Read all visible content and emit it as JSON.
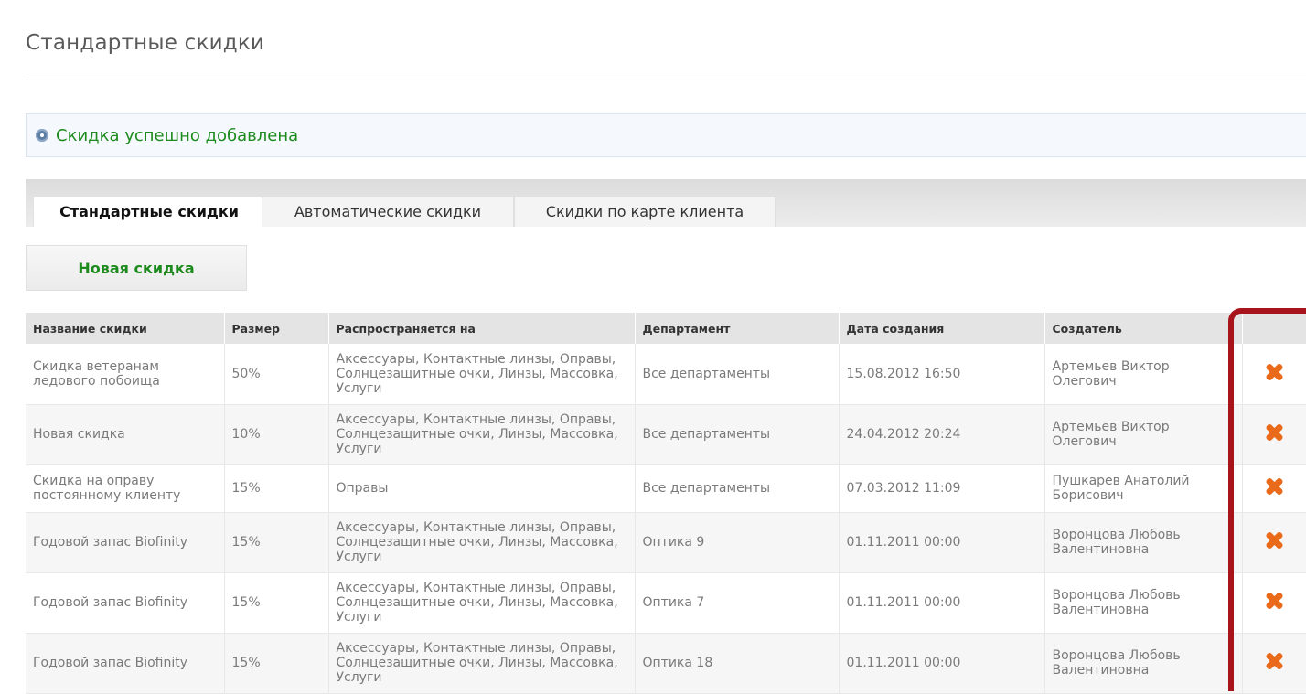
{
  "page": {
    "title": "Стандартные скидки"
  },
  "notice": {
    "text": "Скидка успешно добавлена"
  },
  "tabs": [
    {
      "label": "Стандартные скидки",
      "active": true
    },
    {
      "label": "Автоматические скидки",
      "active": false
    },
    {
      "label": "Скидки по карте клиента",
      "active": false
    }
  ],
  "new_button": {
    "label": "Новая скидка"
  },
  "table": {
    "headers": [
      "Название скидки",
      "Размер",
      "Распространяется на",
      "Департамент",
      "Дата создания",
      "Создатель"
    ],
    "rows": [
      {
        "name": "Скидка ветеранам ледового побоища",
        "size": "50%",
        "applies": "Аксессуары, Контактные линзы, Оправы, Солнцезащитные очки, Линзы, Массовка, Услуги",
        "dept": "Все департаменты",
        "date": "15.08.2012 16:50",
        "creator": "Артемьев Виктор Олегович"
      },
      {
        "name": "Новая скидка",
        "size": "10%",
        "applies": "Аксессуары, Контактные линзы, Оправы, Солнцезащитные очки, Линзы, Массовка, Услуги",
        "dept": "Все департаменты",
        "date": "24.04.2012 20:24",
        "creator": "Артемьев Виктор Олегович"
      },
      {
        "name": "Скидка на оправу постоянному клиенту",
        "size": "15%",
        "applies": "Оправы",
        "dept": "Все департаменты",
        "date": "07.03.2012 11:09",
        "creator": "Пушкарев Анатолий Борисович"
      },
      {
        "name": "Годовой запас Biofinity",
        "size": "15%",
        "applies": "Аксессуары, Контактные линзы, Оправы, Солнцезащитные очки, Линзы, Массовка, Услуги",
        "dept": "Оптика 9",
        "date": "01.11.2011 00:00",
        "creator": "Воронцова Любовь Валентиновна"
      },
      {
        "name": "Годовой запас Biofinity",
        "size": "15%",
        "applies": "Аксессуары, Контактные линзы, Оправы, Солнцезащитные очки, Линзы, Массовка, Услуги",
        "dept": "Оптика 7",
        "date": "01.11.2011 00:00",
        "creator": "Воронцова Любовь Валентиновна"
      },
      {
        "name": "Годовой запас Biofinity",
        "size": "15%",
        "applies": "Аксессуары, Контактные линзы, Оправы, Солнцезащитные очки, Линзы, Массовка, Услуги",
        "dept": "Оптика 18",
        "date": "01.11.2011 00:00",
        "creator": "Воронцова Любовь Валентиновна"
      }
    ],
    "delete_icon": "delete-x-icon"
  },
  "colors": {
    "success_green": "#1c8a1c",
    "delete_orange": "#e86a1a",
    "highlight_red": "#a8141c"
  }
}
